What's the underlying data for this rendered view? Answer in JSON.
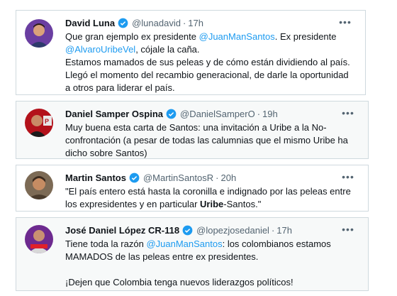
{
  "colors": {
    "link": "#1d9bf0",
    "verified": "#1d9bf0",
    "secondary": "#536471",
    "border": "#cfd9de"
  },
  "more_icon": "more-horizontal-icon",
  "verified_icon": "verified-badge-icon",
  "tweets": [
    {
      "name": "David Luna",
      "handle": "@lunadavid",
      "time": "17h",
      "line1_text": "Que gran ejemplo ex presidente ",
      "line1_mention": "@JuanManSantos",
      "line1_rest": ". Ex presidente",
      "line2_mention": "@AlvaroUribeVel",
      "line2_rest": ", cójale la caña.",
      "para": "Estamos mamados de sus peleas y de cómo están dividiendo al país. Llegó el momento del recambio generacional, de darle la oportunidad a otros para liderar el país."
    },
    {
      "name": "Daniel Samper Ospina",
      "handle": "@DanielSamperO",
      "time": "19h",
      "text": "Muy buena esta carta de Santos: una invitación a Uribe a la No-confrontación (a pesar de todas las calumnias que el mismo Uribe ha dicho sobre Santos)"
    },
    {
      "name": "Martin Santos",
      "handle": "@MartinSantosR",
      "time": "20h",
      "text_a": "\"El país entero está hasta la coronilla e indignado por las peleas entre los expresidentes y en particular ",
      "text_bold": "Uribe",
      "text_b": "-Santos.\""
    },
    {
      "name": "José Daniel López CR-118",
      "handle": "@lopezjosedaniel",
      "time": "17h",
      "text_a": "Tiene toda la razón ",
      "mention": "@JuanManSantos",
      "text_b": ": los colombianos estamos MAMADOS de las peleas entre ex presidentes.",
      "para": "¡Dejen que Colombia tenga nuevos liderazgos políticos!"
    }
  ]
}
